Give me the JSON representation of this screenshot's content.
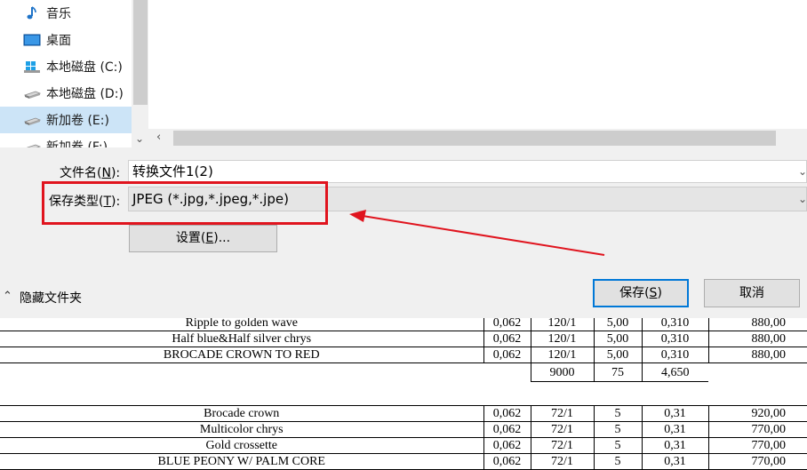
{
  "nav": {
    "items": [
      {
        "label": "音乐",
        "icon": "music-note-icon"
      },
      {
        "label": "桌面",
        "icon": "desktop-icon"
      },
      {
        "label": "本地磁盘 (C:)",
        "icon": "windows-drive-icon"
      },
      {
        "label": "本地磁盘 (D:)",
        "icon": "drive-icon"
      },
      {
        "label": "新加卷 (E:)",
        "icon": "drive-icon"
      },
      {
        "label": "新加卷 (F:)",
        "icon": "drive-icon"
      }
    ],
    "selected_index": 4
  },
  "filename": {
    "label": "文件名",
    "accesskey": "N",
    "value": "转换文件1(2)"
  },
  "filetype": {
    "label": "保存类型",
    "accesskey": "T",
    "value": "JPEG (*.jpg,*.jpeg,*.jpe)"
  },
  "settings_button": {
    "label": "设置",
    "accesskey": "E",
    "suffix": "..."
  },
  "hide_folders": {
    "label": "隐藏文件夹"
  },
  "save_button": {
    "label": "保存",
    "accesskey": "S"
  },
  "cancel_button": {
    "label": "取消"
  },
  "annotation": {
    "highlight_color": "#e0141e",
    "arrow_color": "#e0141e"
  },
  "sheet": {
    "rows": [
      {
        "name": "Ripple to golden wave",
        "a": "0,062",
        "b": "120/1",
        "c": "5,00",
        "d": "0,310",
        "e": "880,00"
      },
      {
        "name": "Half blue&Half silver chrys",
        "a": "0,062",
        "b": "120/1",
        "c": "5,00",
        "d": "0,310",
        "e": "880,00"
      },
      {
        "name": "BROCADE CROWN TO RED",
        "a": "0,062",
        "b": "120/1",
        "c": "5,00",
        "d": "0,310",
        "e": "880,00"
      },
      {
        "name": "",
        "a": "",
        "b": "9000",
        "c": "75",
        "d": "4,650",
        "e": ""
      },
      {
        "name": "",
        "a": "",
        "b": "",
        "c": "",
        "d": "",
        "e": ""
      },
      {
        "name": "Brocade crown",
        "a": "0,062",
        "b": "72/1",
        "c": "5",
        "d": "0,31",
        "e": "920,00"
      },
      {
        "name": "Multicolor chrys",
        "a": "0,062",
        "b": "72/1",
        "c": "5",
        "d": "0,31",
        "e": "770,00"
      },
      {
        "name": "Gold crossette",
        "a": "0,062",
        "b": "72/1",
        "c": "5",
        "d": "0,31",
        "e": "770,00"
      },
      {
        "name": "BLUE PEONY W/ PALM CORE",
        "a": "0,062",
        "b": "72/1",
        "c": "5",
        "d": "0,31",
        "e": "770,00"
      }
    ]
  }
}
